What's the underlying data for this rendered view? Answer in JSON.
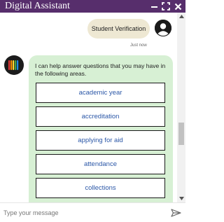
{
  "window": {
    "title": "Digital Assistant",
    "buttons": [
      {
        "name": "minimize-icon"
      },
      {
        "name": "expand-icon"
      },
      {
        "name": "close-icon"
      }
    ],
    "title_bar_color": "#572e6c"
  },
  "conversation": {
    "user_message": "Student Verification",
    "timestamp": "Just now",
    "bot_message": "I can help answer questions that you may have in the following areas.",
    "topics": [
      "academic year",
      "accreditation",
      "applying for aid",
      "attendance",
      "collections"
    ]
  },
  "composer": {
    "placeholder": "Type your message",
    "send_icon": "send-icon"
  },
  "scroll": {
    "position_fraction": 0.62
  }
}
